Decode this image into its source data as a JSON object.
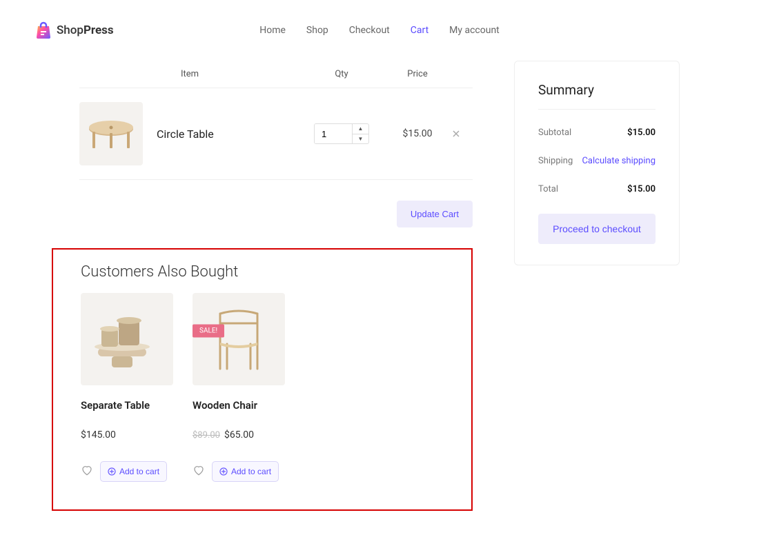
{
  "brand": {
    "name_light": "Shop",
    "name_bold": "Press"
  },
  "nav": {
    "items": [
      "Home",
      "Shop",
      "Checkout",
      "Cart",
      "My account"
    ],
    "active_index": 3
  },
  "cart_head": {
    "item": "Item",
    "qty": "Qty",
    "price": "Price"
  },
  "cart": {
    "items": [
      {
        "name": "Circle Table",
        "qty": "1",
        "price": "$15.00"
      }
    ]
  },
  "update_btn": "Update Cart",
  "cross": {
    "title": "Customers Also Bought",
    "sale_label": "SALE!",
    "add_label": "Add to cart",
    "products": [
      {
        "name": "Separate Table",
        "price": "$145.00",
        "old_price": "",
        "on_sale": false
      },
      {
        "name": "Wooden Chair",
        "price": "$65.00",
        "old_price": "$89.00",
        "on_sale": true
      }
    ]
  },
  "summary": {
    "title": "Summary",
    "subtotal_label": "Subtotal",
    "subtotal": "$15.00",
    "shipping_label": "Shipping",
    "shipping_link": "Calculate shipping",
    "total_label": "Total",
    "total": "$15.00",
    "checkout": "Proceed to checkout"
  }
}
